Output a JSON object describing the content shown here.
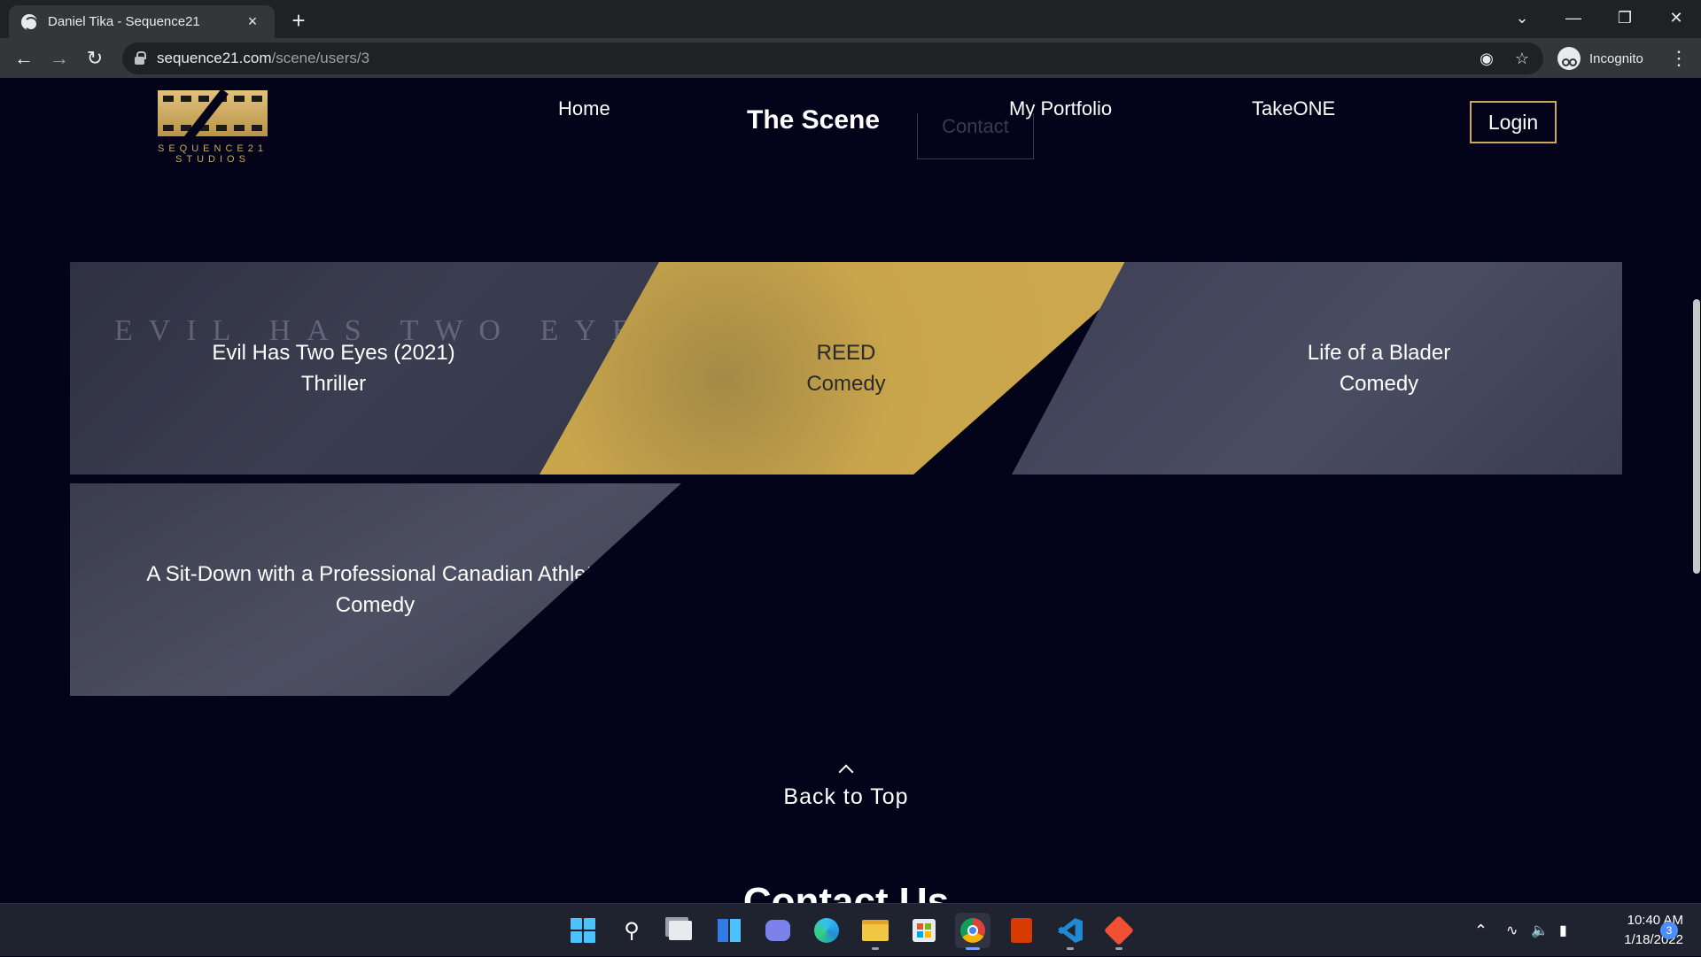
{
  "browser": {
    "tab_title": "Daniel Tika - Sequence21",
    "tab_close": "×",
    "new_tab": "+",
    "url_host": "sequence21.com",
    "url_path": "/scene/users/3",
    "profile_label": "Incognito",
    "icons": [
      "globe-icon",
      "back-arrow-icon",
      "forward-arrow-icon",
      "reload-icon",
      "lock-icon",
      "eye-off-icon",
      "star-icon",
      "incognito-icon",
      "kebab-menu-icon",
      "minimize-icon",
      "restore-icon",
      "close-icon"
    ]
  },
  "site": {
    "logo_text": "SEQUENCE21 STUDIOS",
    "nav": {
      "home": "Home",
      "scene": "The Scene",
      "portfolio": "My Portfolio",
      "takeone": "TakeONE",
      "login": "Login",
      "contact_ghost": "Contact"
    },
    "cards": [
      {
        "title": "Evil Has Two Eyes (2021)",
        "genre": "Thriller",
        "decor": "EVIL HAS TWO EYES"
      },
      {
        "title": "REED",
        "genre": "Comedy"
      },
      {
        "title": "Life of a Blader",
        "genre": "Comedy"
      },
      {
        "title": "A Sit-Down with a Professional Canadian Athlete",
        "genre": "Comedy"
      }
    ],
    "back_to_top": "Back to Top",
    "contact_title": "Contact Us"
  },
  "taskbar": {
    "time": "10:40 AM",
    "date": "1/18/2022",
    "notifications": "3",
    "apps": [
      "windows-start-icon",
      "search-icon",
      "task-view-icon",
      "widgets-icon",
      "teams-chat-icon",
      "edge-icon",
      "file-explorer-icon",
      "store-icon",
      "chrome-icon",
      "office-icon",
      "vscode-icon",
      "git-icon"
    ]
  },
  "colors": {
    "page_bg": "#03031a",
    "gold": "#c9a962",
    "card_gold": "#cda84e",
    "card_slate": "#3b3e50"
  }
}
